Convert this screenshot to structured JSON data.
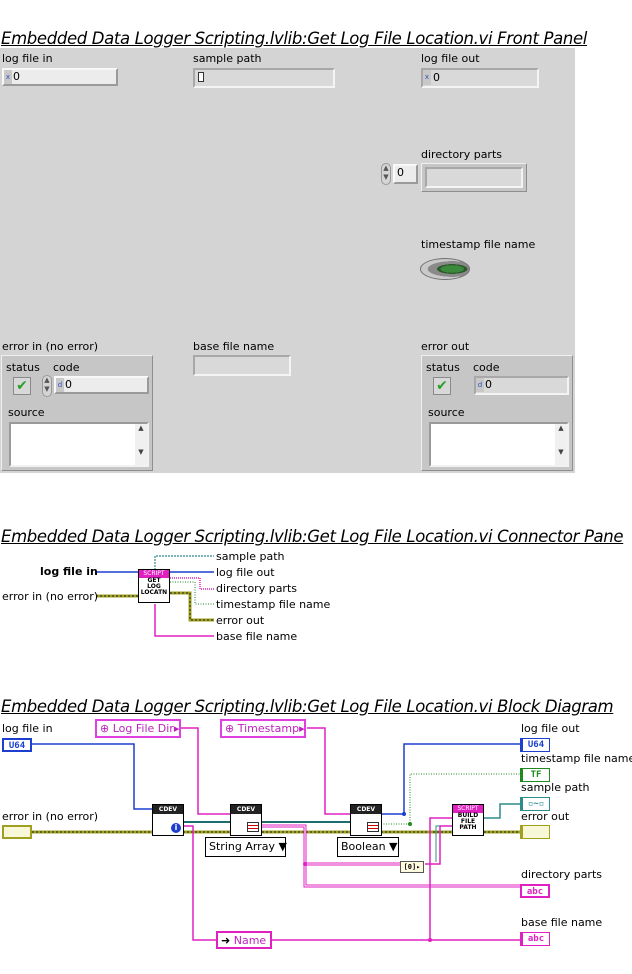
{
  "headings": {
    "front_panel": "Embedded Data Logger Scripting.lvlib:Get Log File Location.vi Front Panel",
    "connector_pane": "Embedded Data Logger Scripting.lvlib:Get Log File Location.vi Connector Pane",
    "block_diagram": "Embedded Data Logger Scripting.lvlib:Get Log File Location.vi Block Diagram"
  },
  "front_panel": {
    "log_file_in": {
      "label": "log file in",
      "radix": "x",
      "value": "0"
    },
    "sample_path": {
      "label": "sample path",
      "icon": "path-icon"
    },
    "log_file_out": {
      "label": "log file out",
      "radix": "x",
      "value": "0"
    },
    "directory_parts": {
      "label": "directory parts",
      "index": "0"
    },
    "timestamp_file_name": {
      "label": "timestamp file name",
      "value": false
    },
    "error_in": {
      "label": "error in (no error)",
      "status_label": "status",
      "code_label": "code",
      "code_radix": "d",
      "code_value": "0",
      "source_label": "source"
    },
    "base_file_name": {
      "label": "base file name"
    },
    "error_out": {
      "label": "error out",
      "status_label": "status",
      "code_label": "code",
      "code_radix": "d",
      "code_value": "0",
      "source_label": "source"
    }
  },
  "connector_pane": {
    "left": [
      "log file in",
      "error in (no error)"
    ],
    "right": [
      "sample path",
      "log file out",
      "directory parts",
      "timestamp file name",
      "error out",
      "base file name"
    ],
    "icon_band": "SCRIPT",
    "icon_text": [
      "GET",
      "LOG",
      "LOCATN"
    ]
  },
  "block_diagram": {
    "inputs": {
      "log_file_in": "log file in",
      "log_file_in_type": "U64",
      "error_in": "error in (no error)"
    },
    "constants": {
      "log_file_dir": "Log File Dir",
      "timestamp": "Timestamp",
      "name": "Name"
    },
    "rings": {
      "string_array": "String Array",
      "boolean": "Boolean"
    },
    "node_band": "CDEV",
    "build_band": "SCRIPT",
    "build_text": [
      "BUILD",
      "FILE",
      "PATH"
    ],
    "outputs": {
      "log_file_out": "log file out",
      "log_file_out_type": "U64",
      "timestamp_file_name": "timestamp file name",
      "timestamp_type": "TF",
      "sample_path": "sample path",
      "error_out": "error out",
      "directory_parts": "directory parts",
      "directory_parts_type": "abc",
      "base_file_name": "base file name",
      "base_file_name_type": "abc"
    }
  },
  "colors": {
    "integer_wire": "#1c3fd0",
    "string_wire": "#e020c0",
    "path_wire": "#2d8c8c",
    "boolean_wire": "#1e8a1e",
    "error_wire": "#a0a020"
  }
}
